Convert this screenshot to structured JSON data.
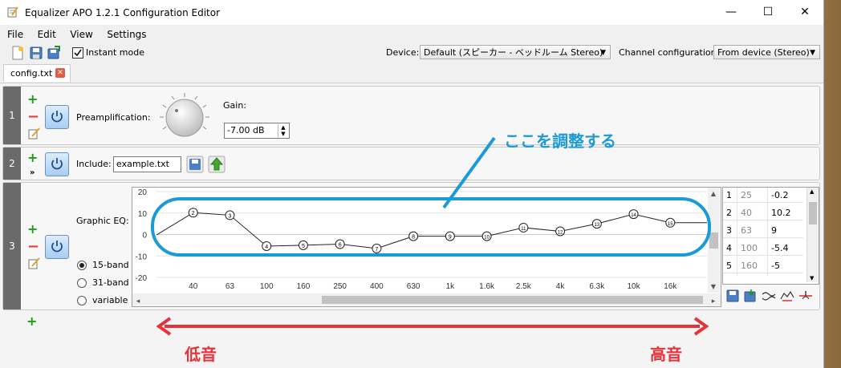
{
  "window": {
    "title": "Equalizer APO 1.2.1 Configuration Editor",
    "minimize_glyph": "—",
    "maximize_glyph": "☐",
    "close_glyph": "✕"
  },
  "menu": [
    "File",
    "Edit",
    "View",
    "Settings"
  ],
  "toolbar": {
    "instant_mode_label": "Instant mode",
    "instant_mode_checked": true,
    "device_label": "Device:",
    "device_value": "Default (スピーカー - ベッドルーム Stereo)",
    "channel_label": "Channel configuration:",
    "channel_value": "From device (Stereo)"
  },
  "tab": {
    "label": "config.txt",
    "close_glyph": "✕"
  },
  "filters": [
    {
      "number": "1",
      "preamp_label": "Preamplification:",
      "gain_label": "Gain:",
      "gain_value": "-7.00 dB"
    },
    {
      "number": "2",
      "include_label": "Include:",
      "include_value": "example.txt"
    },
    {
      "number": "3",
      "eq_label": "Graphic EQ:",
      "band_options": [
        "15-band",
        "31-band",
        "variable"
      ],
      "selected_band": "15-band"
    }
  ],
  "chart_data": {
    "type": "line",
    "ylim": [
      -20,
      20
    ],
    "yticks": [
      "20",
      "10",
      "0",
      "-10",
      "-20"
    ],
    "x_tick_labels": [
      "40",
      "63",
      "100",
      "160",
      "250",
      "400",
      "630",
      "1k",
      "1.6k",
      "2.5k",
      "4k",
      "6.3k",
      "10k",
      "16k"
    ],
    "points": [
      {
        "label": "",
        "freq": "25",
        "gain": -0.2
      },
      {
        "label": "2",
        "freq": "40",
        "gain": 10.2
      },
      {
        "label": "3",
        "freq": "63",
        "gain": 9
      },
      {
        "label": "4",
        "freq": "100",
        "gain": -5.4
      },
      {
        "label": "5",
        "freq": "160",
        "gain": -5
      },
      {
        "label": "6",
        "freq": "250",
        "gain": -4.5
      },
      {
        "label": "7",
        "freq": "400",
        "gain": -6.5
      },
      {
        "label": "8",
        "freq": "630",
        "gain": -0.8
      },
      {
        "label": "9",
        "freq": "1k",
        "gain": -0.8
      },
      {
        "label": "10",
        "freq": "1.6k",
        "gain": -0.8
      },
      {
        "label": "11",
        "freq": "2.5k",
        "gain": 3.2
      },
      {
        "label": "12",
        "freq": "4k",
        "gain": 1.5
      },
      {
        "label": "13",
        "freq": "6.3k",
        "gain": 5
      },
      {
        "label": "14",
        "freq": "10k",
        "gain": 9.5
      },
      {
        "label": "15",
        "freq": "16k",
        "gain": 5.5
      },
      {
        "label": "",
        "freq": "",
        "gain": 5.5
      }
    ]
  },
  "band_table": [
    {
      "index": "1",
      "freq": "25",
      "gain": "-0.2"
    },
    {
      "index": "2",
      "freq": "40",
      "gain": "10.2"
    },
    {
      "index": "3",
      "freq": "63",
      "gain": "9"
    },
    {
      "index": "4",
      "freq": "100",
      "gain": "-5.4"
    },
    {
      "index": "5",
      "freq": "160",
      "gain": "-5"
    }
  ],
  "annotations": {
    "adjust_here": "ここを調整する",
    "low": "低音",
    "high": "高音",
    "accent_blue": "#1a9bd7",
    "accent_red": "#e8323a"
  }
}
